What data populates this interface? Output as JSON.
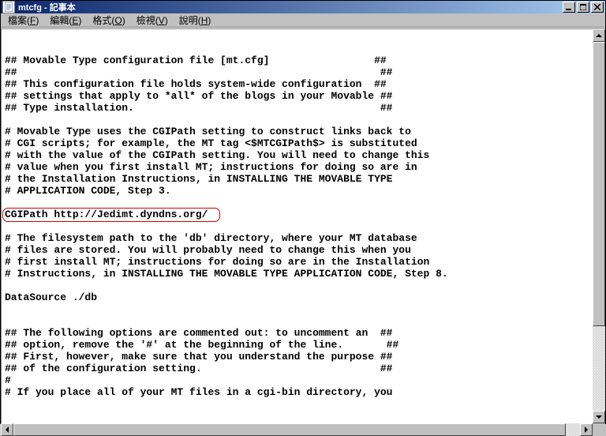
{
  "window": {
    "title": "mtcfg - 記事本"
  },
  "menu": {
    "file": "檔案(F)",
    "edit": "編輯(E)",
    "format": "格式(O)",
    "view": "檢視(V)",
    "help": "說明(H)"
  },
  "editor": {
    "lines": [
      "## Movable Type configuration file [mt.cfg]                 ##",
      "##                                                           ##",
      "## This configuration file holds system-wide configuration  ##",
      "## settings that apply to *all* of the blogs in your Movable ##",
      "## Type installation.                                        ##",
      "",
      "# Movable Type uses the CGIPath setting to construct links back to",
      "# CGI scripts; for example, the MT tag <$MTCGIPath$> is substituted",
      "# with the value of the CGIPath setting. You will need to change this",
      "# value when you first install MT; instructions for doing so are in",
      "# the Installation Instructions, in INSTALLING THE MOVABLE TYPE",
      "# APPLICATION CODE, Step 3.",
      "",
      "CGIPath http://Jedimt.dyndns.org/",
      "",
      "# The filesystem path to the 'db' directory, where your MT database",
      "# files are stored. You will probably need to change this when you",
      "# first install MT; instructions for doing so are in the Installation",
      "# Instructions, in INSTALLING THE MOVABLE TYPE APPLICATION CODE, Step 8.",
      "",
      "DataSource ./db",
      "",
      "",
      "## The following options are commented out: to uncomment an  ##",
      "## option, remove the '#' at the beginning of the line.       ##",
      "## First, however, make sure that you understand the purpose ##",
      "## of the configuration setting.                             ##",
      "#",
      "# If you place all of your MT files in a cgi-bin directory, you"
    ],
    "highlighted_line_text": "CGIPath http://Jedimt.dyndns.org/"
  }
}
